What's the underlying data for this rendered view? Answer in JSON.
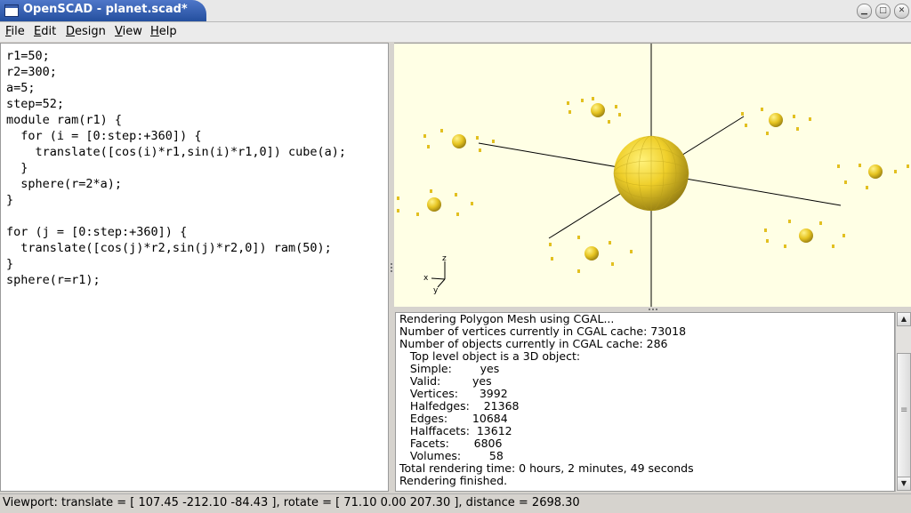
{
  "window": {
    "title": "OpenSCAD - planet.scad*",
    "buttons": [
      "minimize",
      "maximize",
      "close"
    ]
  },
  "menu": {
    "items": [
      {
        "label": "File",
        "mnemonic": "F",
        "rest": "ile"
      },
      {
        "label": "Edit",
        "mnemonic": "E",
        "rest": "dit"
      },
      {
        "label": "Design",
        "mnemonic": "D",
        "rest": "esign"
      },
      {
        "label": "View",
        "mnemonic": "V",
        "rest": "iew"
      },
      {
        "label": "Help",
        "mnemonic": "H",
        "rest": "elp"
      }
    ]
  },
  "editor": {
    "code": "r1=50;\nr2=300;\na=5;\nstep=52;\nmodule ram(r1) {\n  for (i = [0:step:+360]) {\n    translate([cos(i)*r1,sin(i)*r1,0]) cube(a);\n  }\n  sphere(r=2*a);\n}\n\nfor (j = [0:step:+360]) {\n  translate([cos(j)*r2,sin(j)*r2,0]) ram(50);\n}\nsphere(r=r1);"
  },
  "viewer": {
    "background_color": "#ffffe5",
    "object_color": "#f2d52a",
    "axis_labels": {
      "x": "x",
      "y": "y",
      "z": "z"
    }
  },
  "console": {
    "lines": [
      "Rendering Polygon Mesh using CGAL...",
      "Number of vertices currently in CGAL cache: 73018",
      "Number of objects currently in CGAL cache: 286",
      "   Top level object is a 3D object:",
      "   Simple:        yes",
      "   Valid:         yes",
      "   Vertices:      3992",
      "   Halfedges:    21368",
      "   Edges:       10684",
      "   Halffacets:  13612",
      "   Facets:       6806",
      "   Volumes:        58",
      "Total rendering time: 0 hours, 2 minutes, 49 seconds",
      "Rendering finished."
    ]
  },
  "status": {
    "text": "Viewport: translate = [ 107.45 -212.10 -84.43 ], rotate = [ 71.10 0.00 207.30 ], distance = 2698.30"
  }
}
